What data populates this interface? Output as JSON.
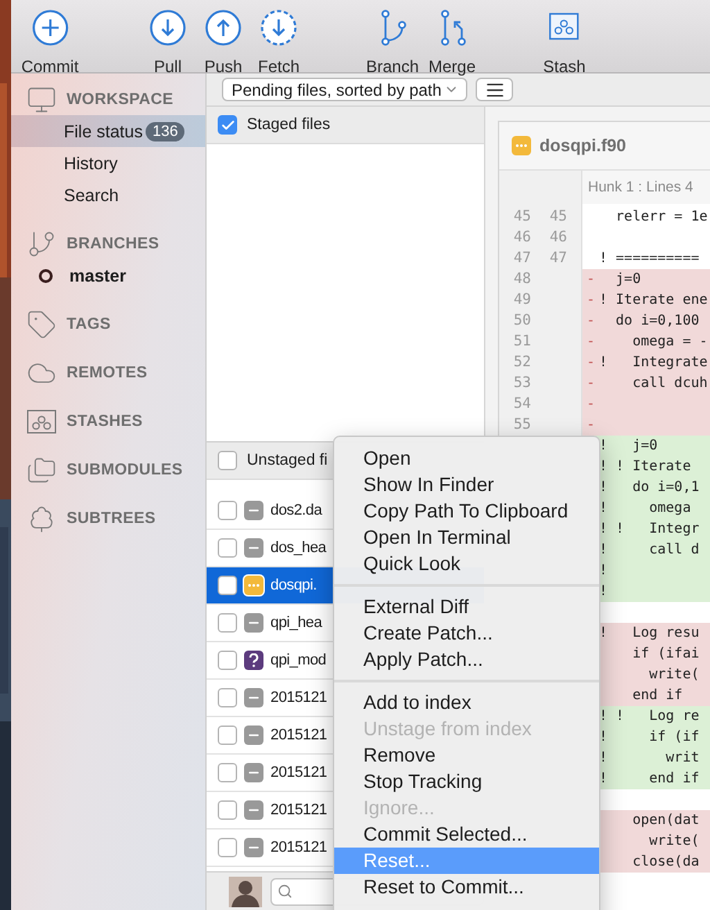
{
  "toolbar": [
    {
      "label": "Commit"
    },
    {
      "label": "Pull"
    },
    {
      "label": "Push"
    },
    {
      "label": "Fetch"
    },
    {
      "label": "Branch"
    },
    {
      "label": "Merge"
    },
    {
      "label": "Stash"
    }
  ],
  "sidebar": [
    {
      "title": "WORKSPACE",
      "items": [
        {
          "label": "File status",
          "badge": "136",
          "selected": true
        },
        {
          "label": "History",
          "selected": false
        },
        {
          "label": "Search",
          "selected": false
        }
      ]
    },
    {
      "title": "BRANCHES",
      "items": [
        {
          "label": "master",
          "current": true,
          "selected": false
        }
      ]
    },
    {
      "title": "TAGS"
    },
    {
      "title": "REMOTES"
    },
    {
      "title": "STASHES"
    },
    {
      "title": "SUBMODULES"
    },
    {
      "title": "SUBTREES"
    }
  ],
  "view_picker": {
    "value": "Pending files, sorted by path"
  },
  "staged": {
    "label": "Staged files",
    "checked": true
  },
  "unstaged": {
    "label": "Unstaged fi",
    "checked": false,
    "files": [
      {
        "name": "dos2.da",
        "kind": "missing",
        "checked": false,
        "selected": false
      },
      {
        "name": "dos_hea",
        "kind": "missing",
        "checked": false,
        "selected": false
      },
      {
        "name": "dosqpi.",
        "kind": "modified",
        "checked": false,
        "selected": true
      },
      {
        "name": "qpi_hea",
        "kind": "missing",
        "checked": false,
        "selected": false
      },
      {
        "name": "qpi_mod",
        "kind": "untracked",
        "checked": false,
        "selected": false
      },
      {
        "name": "2015121",
        "kind": "missing",
        "checked": false,
        "selected": false
      },
      {
        "name": "2015121",
        "kind": "missing",
        "checked": false,
        "selected": false
      },
      {
        "name": "2015121",
        "kind": "missing",
        "checked": false,
        "selected": false
      },
      {
        "name": "2015121",
        "kind": "missing",
        "checked": false,
        "selected": false
      },
      {
        "name": "2015121",
        "kind": "missing",
        "checked": false,
        "selected": false
      }
    ]
  },
  "diff": {
    "file": "dosqpi.f90",
    "kind": "modified",
    "hunk": "Hunk 1 : Lines 4",
    "lines": [
      {
        "old": "45",
        "new": "45",
        "kind": "context",
        "code": "  relerr = 1e"
      },
      {
        "old": "46",
        "new": "46",
        "kind": "context"
      },
      {
        "old": "47",
        "new": "47",
        "kind": "context",
        "code": "! =========="
      },
      {
        "old": "48",
        "kind": "removed",
        "marker": "-",
        "code": "  j=0"
      },
      {
        "old": "49",
        "kind": "removed",
        "marker": "-",
        "code": "! Iterate ene"
      },
      {
        "old": "50",
        "kind": "removed",
        "marker": "-",
        "code": "  do i=0,100"
      },
      {
        "old": "51",
        "kind": "removed",
        "marker": "-",
        "code": "    omega = -"
      },
      {
        "old": "52",
        "kind": "removed",
        "marker": "-",
        "code": "!   Integrate"
      },
      {
        "old": "53",
        "kind": "removed",
        "marker": "-",
        "code": "    call dcuh"
      },
      {
        "old": "54",
        "kind": "removed",
        "marker": "-"
      },
      {
        "old": "55",
        "kind": "removed",
        "marker": "-"
      },
      {
        "kind": "added",
        "code": "!   j=0"
      },
      {
        "kind": "added",
        "code": "! ! Iterate"
      },
      {
        "kind": "added",
        "code": "!   do i=0,1"
      },
      {
        "kind": "added",
        "code": "!     omega"
      },
      {
        "kind": "added",
        "code": "! !   Integr"
      },
      {
        "kind": "added",
        "code": "!     call d"
      },
      {
        "kind": "added",
        "code": "!"
      },
      {
        "kind": "added",
        "code": "!"
      },
      {
        "kind": "context"
      },
      {
        "kind": "removed",
        "code": "!   Log resu"
      },
      {
        "kind": "removed",
        "code": "    if (ifai"
      },
      {
        "kind": "removed",
        "code": "      write("
      },
      {
        "kind": "removed",
        "code": "    end if"
      },
      {
        "kind": "added",
        "code": "! !   Log re"
      },
      {
        "kind": "added",
        "code": "!     if (if"
      },
      {
        "kind": "added",
        "code": "!       writ"
      },
      {
        "kind": "added",
        "code": "!     end if"
      },
      {
        "kind": "context"
      },
      {
        "kind": "removed",
        "code": "    open(dat"
      },
      {
        "kind": "removed",
        "code": "      write("
      },
      {
        "kind": "removed",
        "code": "    close(da"
      }
    ]
  },
  "context_menu": [
    [
      {
        "label": "Open",
        "disabled": false,
        "highlighted": false
      },
      {
        "label": "Show In Finder",
        "disabled": false,
        "highlighted": false
      },
      {
        "label": "Copy Path To Clipboard",
        "disabled": false,
        "highlighted": false
      },
      {
        "label": "Open In Terminal",
        "disabled": false,
        "highlighted": false
      },
      {
        "label": "Quick Look",
        "disabled": false,
        "highlighted": false
      }
    ],
    [
      {
        "label": "External Diff",
        "disabled": false,
        "highlighted": false
      },
      {
        "label": "Create Patch...",
        "disabled": false,
        "highlighted": false
      },
      {
        "label": "Apply Patch...",
        "disabled": false,
        "highlighted": false
      }
    ],
    [
      {
        "label": "Add to index",
        "disabled": false,
        "highlighted": false
      },
      {
        "label": "Unstage from index",
        "disabled": true,
        "highlighted": false
      },
      {
        "label": "Remove",
        "disabled": false,
        "highlighted": false
      },
      {
        "label": "Stop Tracking",
        "disabled": false,
        "highlighted": false
      },
      {
        "label": "Ignore...",
        "disabled": true,
        "highlighted": false
      },
      {
        "label": "Commit Selected...",
        "disabled": false,
        "highlighted": false
      },
      {
        "label": "Reset...",
        "disabled": false,
        "highlighted": true
      },
      {
        "label": "Reset to Commit...",
        "disabled": false,
        "highlighted": false
      }
    ]
  ]
}
